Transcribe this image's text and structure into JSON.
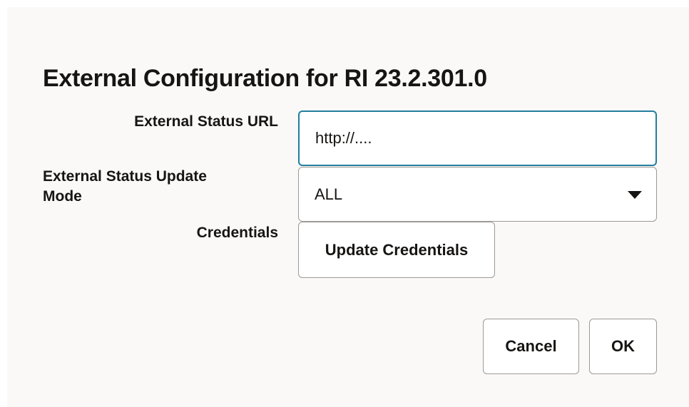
{
  "dialog": {
    "title": "External Configuration for RI 23.2.301.0",
    "fields": {
      "status_url": {
        "label": "External Status URL",
        "value": "http://...."
      },
      "update_mode": {
        "label_line1": "External Status Update",
        "label_line2": "Mode",
        "selected": "ALL",
        "icon": "chevron-down-icon"
      },
      "credentials": {
        "label": "Credentials",
        "button_label": "Update Credentials"
      }
    },
    "buttons": {
      "cancel_label": "Cancel",
      "ok_label": "OK"
    }
  },
  "colors": {
    "dialog_background": "#fbf9f8",
    "focus_border": "#227e9e",
    "field_border": "#9e9892",
    "text": "#161513"
  }
}
